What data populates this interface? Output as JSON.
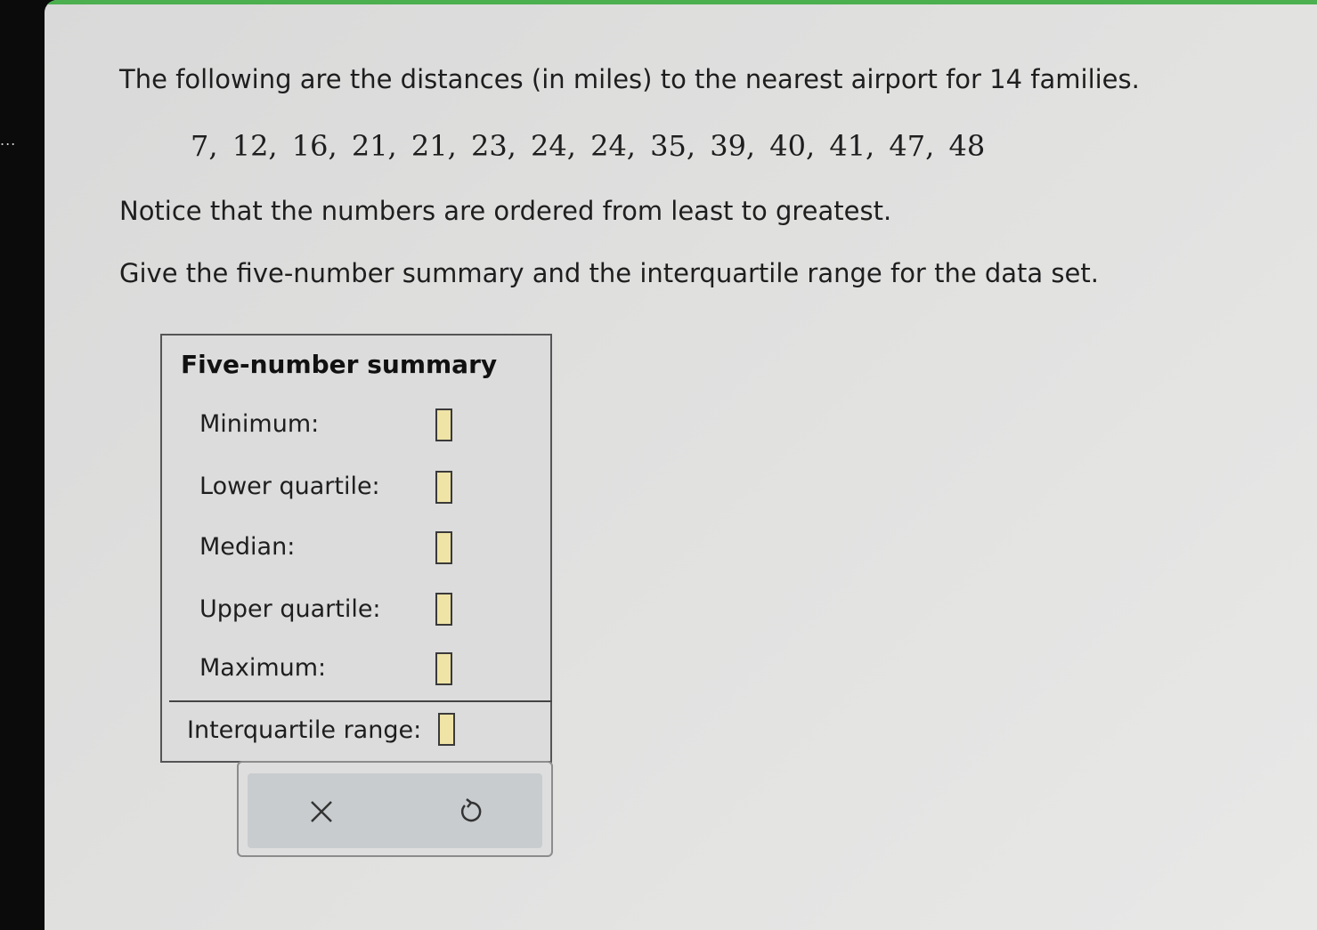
{
  "question": {
    "intro": "The following are the distances (in miles) to the nearest airport for 14 families.",
    "data_values": "7, 12, 16, 21, 21, 23, 24, 24, 35, 39, 40, 41, 47, 48",
    "notice": "Notice that the numbers are ordered from least to greatest.",
    "instruction": "Give the five-number summary and the interquartile range for the data set."
  },
  "summary_panel": {
    "title": "Five-number summary",
    "rows": [
      {
        "label": "Minimum:",
        "value": ""
      },
      {
        "label": "Lower quartile:",
        "value": ""
      },
      {
        "label": "Median:",
        "value": ""
      },
      {
        "label": "Upper quartile:",
        "value": ""
      },
      {
        "label": "Maximum:",
        "value": ""
      }
    ],
    "iqr": {
      "label": "Interquartile range:",
      "value": ""
    }
  },
  "toolbar": {
    "clear_icon": "close-icon",
    "undo_icon": "undo-icon"
  },
  "colors": {
    "top_bar": "#4caf50",
    "answer_box_fill": "#efe3a6"
  },
  "side_indicator": "..."
}
